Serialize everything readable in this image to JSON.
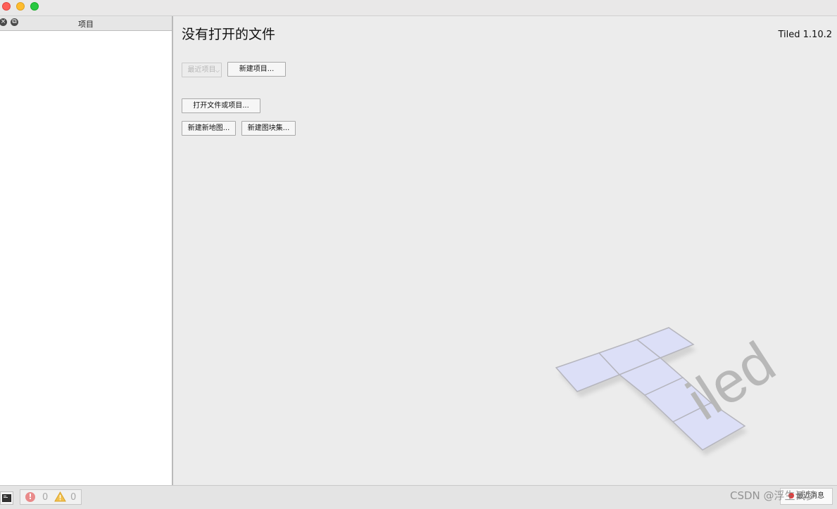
{
  "window": {
    "controls": [
      "close",
      "minimize",
      "zoom"
    ]
  },
  "sidebar": {
    "title": "项目",
    "close_icon": "close-icon",
    "float_icon": "float-icon"
  },
  "main": {
    "heading": "没有打开的文件",
    "version": "Tiled 1.10.2",
    "recent_projects_label": "最近项目",
    "new_project_label": "新建项目...",
    "open_file_label": "打开文件或项目...",
    "new_map_label": "新建新地图...",
    "new_tileset_label": "新建图块集...",
    "logo_text": "iled"
  },
  "statusbar": {
    "error_count": "0",
    "warning_count": "0",
    "news_label": "最近消息",
    "watermark": "CSDN @浮生试梦"
  },
  "colors": {
    "close": "#ff5f57",
    "minimize": "#febc2e",
    "zoom": "#28c840",
    "error": "#e98a8a",
    "warning": "#f2c14e",
    "logo_tile": "#dcdff7"
  }
}
